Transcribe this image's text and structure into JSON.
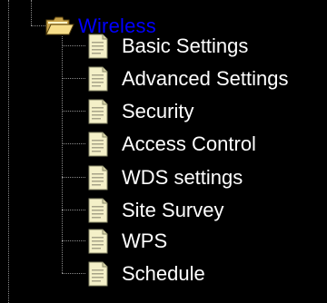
{
  "tree": {
    "folder": {
      "label": "Wireless",
      "icon": "open-folder-icon",
      "color": "#0000ff"
    },
    "items": [
      {
        "label": "Basic Settings",
        "icon": "document-icon"
      },
      {
        "label": "Advanced Settings",
        "icon": "document-icon"
      },
      {
        "label": "Security",
        "icon": "document-icon"
      },
      {
        "label": "Access Control",
        "icon": "document-icon"
      },
      {
        "label": "WDS settings",
        "icon": "document-icon"
      },
      {
        "label": "Site Survey",
        "icon": "document-icon"
      },
      {
        "label": "WPS",
        "icon": "document-icon"
      },
      {
        "label": "Schedule",
        "icon": "document-icon"
      }
    ]
  }
}
